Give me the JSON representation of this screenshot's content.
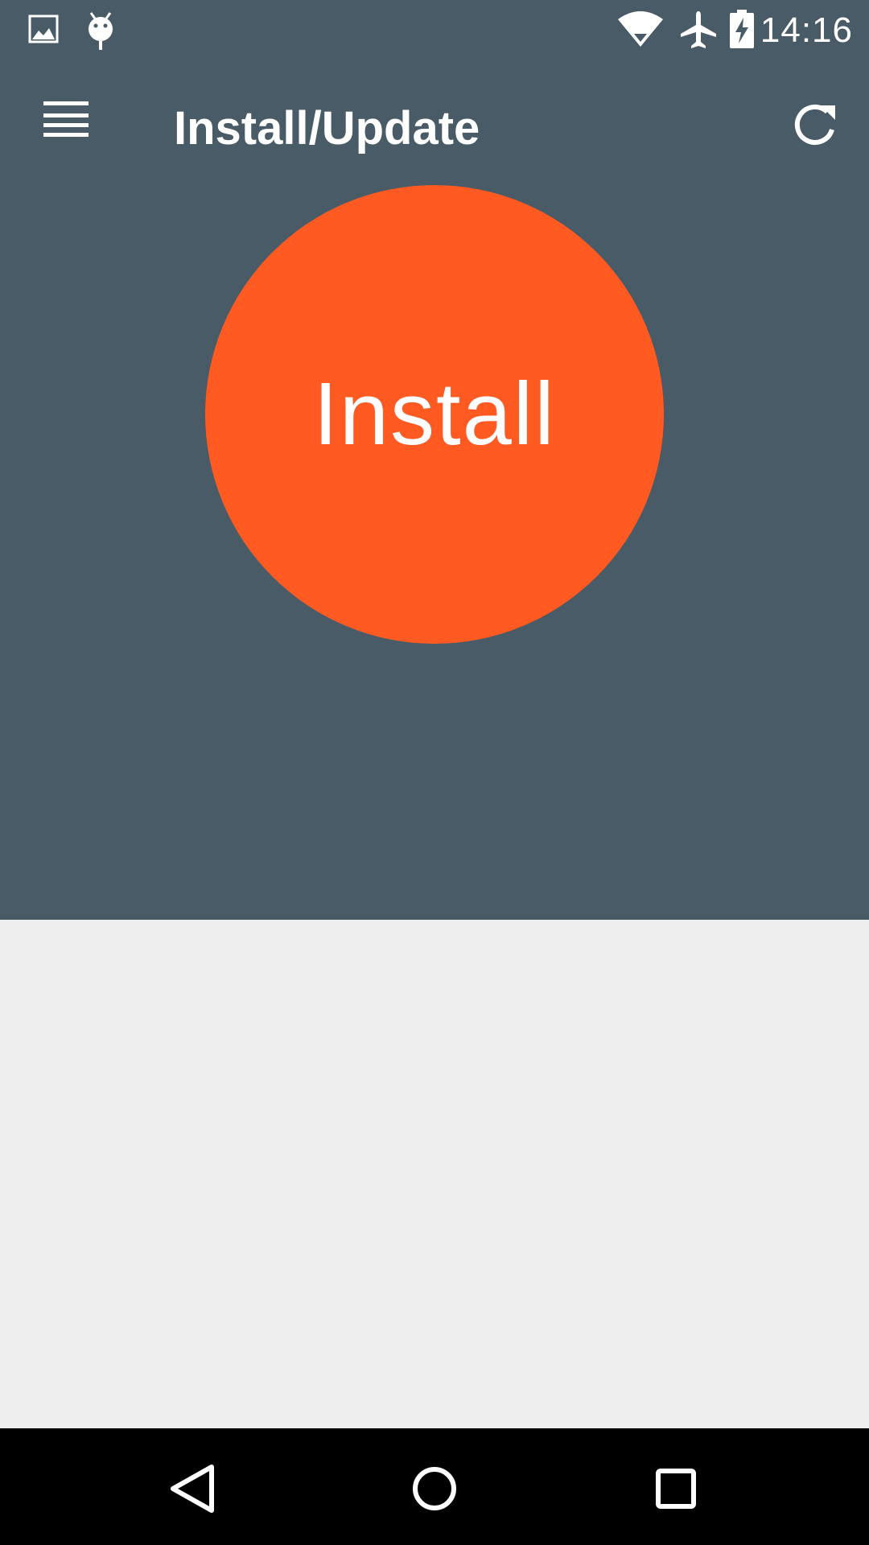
{
  "status_bar": {
    "time": "14:16",
    "icons": [
      "image-notification-icon",
      "android-debug-icon",
      "wifi-icon",
      "airplane-mode-icon",
      "battery-charging-icon"
    ]
  },
  "toolbar": {
    "title": "Install/Update",
    "menu_icon": "hamburger-menu-icon",
    "refresh_icon": "refresh-icon"
  },
  "main": {
    "install_label": "Install"
  },
  "nav_bar": {
    "icons": [
      "back-icon",
      "home-icon",
      "recents-icon"
    ]
  },
  "colors": {
    "top_background": "#485b66",
    "bottom_background": "#eeeeee",
    "install_button": "#ff5a22",
    "nav_background": "#000000"
  }
}
